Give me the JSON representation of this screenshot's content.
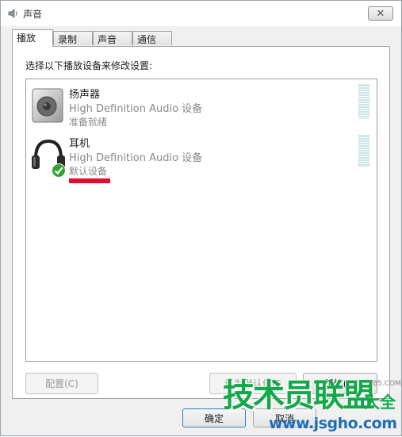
{
  "window": {
    "title": "声音",
    "close_symbol": "✕"
  },
  "tabs": [
    {
      "label": "播放",
      "active": true
    },
    {
      "label": "录制",
      "active": false
    },
    {
      "label": "声音",
      "active": false
    },
    {
      "label": "通信",
      "active": false
    }
  ],
  "panel": {
    "instruction": "选择以下播放设备来修改设置:",
    "devices": [
      {
        "name": "扬声器",
        "driver": "High Definition Audio 设备",
        "status": "准备就绪",
        "icon": "speaker-icon",
        "default": false
      },
      {
        "name": "耳机",
        "driver": "High Definition Audio 设备",
        "status": "默认设备",
        "icon": "headphones-icon",
        "default": true
      }
    ],
    "highlight_color": "#e60b2a"
  },
  "buttons": {
    "configure": "配置(C)",
    "set_default": "设为默认值(S",
    "properties": "属性(P)",
    "ok": "确定",
    "cancel": "取消"
  },
  "watermark": {
    "main": "技术员联盟",
    "side": "大全",
    "url": "www.jsgho.com",
    "small": "P85.COM"
  },
  "colors": {
    "window_bg": "#f0f0f0",
    "meter": "#c9e6e4",
    "check_green": "#2ea62e",
    "watermark_green": "#13a84a",
    "watermark_blue": "#1f6fb8"
  }
}
